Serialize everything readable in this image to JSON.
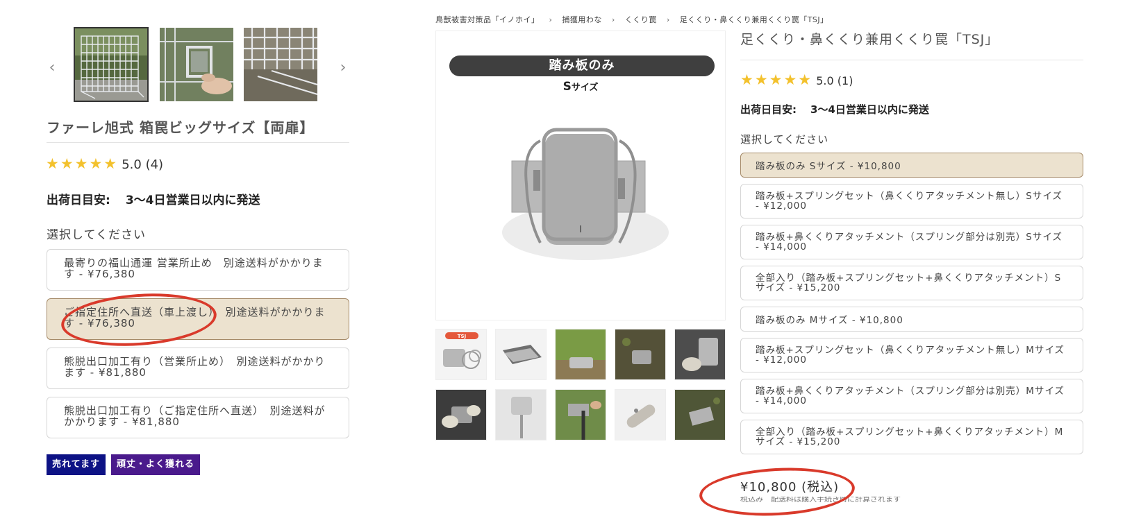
{
  "left_product": {
    "title": "ファーレ旭式 箱罠ビッグサイズ【両扉】",
    "rating_stars": "★★★★★",
    "rating_text": "5.0 (4)",
    "shipping_label": "出荷日目安:",
    "shipping_value": "3〜4日営業日以内に発送",
    "select_label": "選択してください",
    "options": [
      {
        "label": "最寄りの福山通運 営業所止め　別途送料がかかります - ¥76,380",
        "selected": false
      },
      {
        "label": "ご指定住所へ直送（車上渡し）　別途送料がかかります - ¥76,380",
        "selected": true
      },
      {
        "label": "熊脱出口加工有り（営業所止め）　別途送料がかかります - ¥81,880",
        "selected": false
      },
      {
        "label": "熊脱出口加工有り（ご指定住所へ直送）　別途送料がかかります - ¥81,880",
        "selected": false
      }
    ],
    "badges": [
      {
        "label": "売れてます",
        "color": "#0d1285"
      },
      {
        "label": "頑丈・よく獲れる",
        "color": "#4a1a8c"
      }
    ],
    "carousel_prev": "‹",
    "carousel_next": "›"
  },
  "right_product": {
    "breadcrumb": [
      "鳥獣被害対策品「イノホイ」",
      "捕獲用わな",
      "くくり罠",
      "足くくり・鼻くくり兼用くくり罠「TSJ」"
    ],
    "breadcrumb_separator": "›",
    "title": "足くくり・鼻くくり兼用くくり罠「TSJ」",
    "rating_stars": "★★★★★",
    "rating_text": "5.0 (1)",
    "shipping_label": "出荷日目安:",
    "shipping_value": "3〜4日営業日以内に発送",
    "select_label": "選択してください",
    "image_banner": "踏み板のみ",
    "image_size_letter": "S",
    "image_size_word": "サイズ",
    "thumb_tag": "TSJ",
    "options": [
      {
        "label": "踏み板のみ Sサイズ - ¥10,800",
        "selected": true
      },
      {
        "label": "踏み板+スプリングセット（鼻くくりアタッチメント無し）Sサイズ - ¥12,000",
        "selected": false
      },
      {
        "label": "踏み板+鼻くくりアタッチメント（スプリング部分は別売）Sサイズ - ¥14,000",
        "selected": false
      },
      {
        "label": "全部入り（踏み板+スプリングセット+鼻くくりアタッチメント）Sサイズ - ¥15,200",
        "selected": false
      },
      {
        "label": "踏み板のみ Mサイズ - ¥10,800",
        "selected": false
      },
      {
        "label": "踏み板+スプリングセット（鼻くくりアタッチメント無し）Mサイズ - ¥12,000",
        "selected": false
      },
      {
        "label": "踏み板+鼻くくりアタッチメント（スプリング部分は別売）Mサイズ - ¥14,000",
        "selected": false
      },
      {
        "label": "全部入り（踏み板+スプリングセット+鼻くくりアタッチメント）Mサイズ - ¥15,200",
        "selected": false
      }
    ],
    "price": "¥10,800 (税込)",
    "tax_note": "税込み　配送料は購入手続き時に計算されます"
  },
  "colors": {
    "selected_bg": "#ece2cf",
    "selected_border": "#a58a68",
    "star": "#f3c12c",
    "annotation": "#d93a2b"
  }
}
